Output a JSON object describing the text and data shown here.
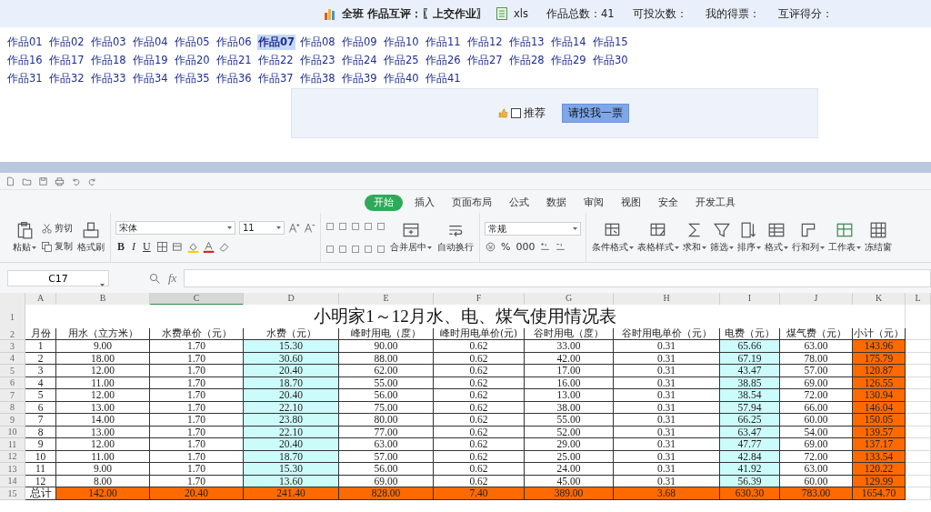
{
  "header": {
    "title": "全班 作品互评：〖上交作业〗",
    "file_type": "xls",
    "stats": [
      "作品总数：41",
      "可投次数：",
      "我的得票：",
      "互评得分："
    ]
  },
  "works": [
    {
      "label": "作品01",
      "selected": false
    },
    {
      "label": "作品02",
      "selected": false
    },
    {
      "label": "作品03",
      "selected": false
    },
    {
      "label": "作品04",
      "selected": false
    },
    {
      "label": "作品05",
      "selected": false
    },
    {
      "label": "作品06",
      "selected": false
    },
    {
      "label": "作品07",
      "selected": true
    },
    {
      "label": "作品08",
      "selected": false
    },
    {
      "label": "作品09",
      "selected": false
    },
    {
      "label": "作品10",
      "selected": false
    },
    {
      "label": "作品11",
      "selected": false
    },
    {
      "label": "作品12",
      "selected": false
    },
    {
      "label": "作品13",
      "selected": false
    },
    {
      "label": "作品14",
      "selected": false
    },
    {
      "label": "作品15",
      "selected": false
    },
    {
      "label": "作品16",
      "selected": false
    },
    {
      "label": "作品17",
      "selected": false
    },
    {
      "label": "作品18",
      "selected": false
    },
    {
      "label": "作品19",
      "selected": false
    },
    {
      "label": "作品20",
      "selected": false
    },
    {
      "label": "作品21",
      "selected": false
    },
    {
      "label": "作品22",
      "selected": false
    },
    {
      "label": "作品23",
      "selected": false
    },
    {
      "label": "作品24",
      "selected": false
    },
    {
      "label": "作品25",
      "selected": false
    },
    {
      "label": "作品26",
      "selected": false
    },
    {
      "label": "作品27",
      "selected": false
    },
    {
      "label": "作品28",
      "selected": false
    },
    {
      "label": "作品29",
      "selected": false
    },
    {
      "label": "作品30",
      "selected": false
    },
    {
      "label": "作品31",
      "selected": false
    },
    {
      "label": "作品32",
      "selected": false
    },
    {
      "label": "作品33",
      "selected": false
    },
    {
      "label": "作品34",
      "selected": false
    },
    {
      "label": "作品35",
      "selected": false
    },
    {
      "label": "作品36",
      "selected": false
    },
    {
      "label": "作品37",
      "selected": false
    },
    {
      "label": "作品38",
      "selected": false
    },
    {
      "label": "作品39",
      "selected": false
    },
    {
      "label": "作品40",
      "selected": false
    },
    {
      "label": "作品41",
      "selected": false
    }
  ],
  "vote": {
    "recommend_label": "推荐",
    "recommend_checked": false,
    "button": "请投我一票"
  },
  "spreadsheet": {
    "tabs": [
      {
        "label": "开始",
        "selected": true
      },
      {
        "label": "插入",
        "selected": false
      },
      {
        "label": "页面布局",
        "selected": false
      },
      {
        "label": "公式",
        "selected": false
      },
      {
        "label": "数据",
        "selected": false
      },
      {
        "label": "审阅",
        "selected": false
      },
      {
        "label": "视图",
        "selected": false
      },
      {
        "label": "安全",
        "selected": false
      },
      {
        "label": "开发工具",
        "selected": false
      }
    ],
    "ribbon": {
      "clipboard": {
        "paste": "粘贴",
        "cut": "剪切",
        "copy": "复制",
        "format_painter": "格式刷"
      },
      "font": {
        "name": "宋体",
        "size": "11",
        "styles": [
          "B",
          "I",
          "U"
        ]
      },
      "alignment": {
        "merge": "合并居中",
        "wrap": "自动换行"
      },
      "number": {
        "format": "常规",
        "percent": "%",
        "thousands": "000"
      },
      "tools": [
        {
          "label": "条件格式",
          "kind": "condition",
          "dropdown": true
        },
        {
          "label": "表格样式",
          "kind": "style",
          "dropdown": true
        },
        {
          "label": "求和",
          "kind": "sum",
          "dropdown": true
        },
        {
          "label": "筛选",
          "kind": "filter",
          "dropdown": true
        },
        {
          "label": "排序",
          "kind": "sort",
          "dropdown": true
        },
        {
          "label": "格式",
          "kind": "format",
          "dropdown": true
        },
        {
          "label": "行和列",
          "kind": "rowcol",
          "dropdown": true
        },
        {
          "label": "工作表",
          "kind": "sheet",
          "dropdown": true
        },
        {
          "label": "冻结窗",
          "kind": "freeze",
          "dropdown": false
        }
      ]
    },
    "formula_bar": {
      "cell": "C17",
      "fx": "fx"
    },
    "columns": [
      {
        "letter": "A",
        "selected": false,
        "kind": "plain"
      },
      {
        "letter": "B",
        "selected": false,
        "kind": "plain"
      },
      {
        "letter": "C",
        "selected": true,
        "kind": "plain"
      },
      {
        "letter": "D",
        "selected": false,
        "kind": "calc"
      },
      {
        "letter": "E",
        "selected": false,
        "kind": "plain"
      },
      {
        "letter": "F",
        "selected": false,
        "kind": "plain"
      },
      {
        "letter": "G",
        "selected": false,
        "kind": "plain"
      },
      {
        "letter": "H",
        "selected": false,
        "kind": "plain"
      },
      {
        "letter": "I",
        "selected": false,
        "kind": "calc"
      },
      {
        "letter": "J",
        "selected": false,
        "kind": "plain"
      },
      {
        "letter": "K",
        "selected": false,
        "kind": "sum"
      },
      {
        "letter": "L",
        "selected": false
      }
    ],
    "title_row": {
      "number": "1",
      "title": "小明家1～12月水、电、煤气使用情况表"
    },
    "header_row": {
      "number": "2",
      "cells": [
        "月份",
        "用水（立方米）",
        "水费单价（元）",
        "水费（元）",
        "峰时用电（度）",
        "峰时用电单价(元)",
        "谷时用电（度）",
        "谷时用电单价（元）",
        "电费（元）",
        "煤气费（元）",
        "小计（元）"
      ]
    },
    "rows": [
      {
        "number": "3",
        "kind": "data",
        "cells": [
          "1",
          "9.00",
          "1.70",
          "15.30",
          "90.00",
          "0.62",
          "33.00",
          "0.31",
          "65.66",
          "63.00",
          "143.96"
        ]
      },
      {
        "number": "4",
        "kind": "data",
        "cells": [
          "2",
          "18.00",
          "1.70",
          "30.60",
          "88.00",
          "0.62",
          "42.00",
          "0.31",
          "67.19",
          "78.00",
          "175.79"
        ]
      },
      {
        "number": "5",
        "kind": "data",
        "cells": [
          "3",
          "12.00",
          "1.70",
          "20.40",
          "62.00",
          "0.62",
          "17.00",
          "0.31",
          "43.47",
          "57.00",
          "120.87"
        ]
      },
      {
        "number": "6",
        "kind": "data",
        "cells": [
          "4",
          "11.00",
          "1.70",
          "18.70",
          "55.00",
          "0.62",
          "16.00",
          "0.31",
          "38.85",
          "69.00",
          "126.55"
        ]
      },
      {
        "number": "7",
        "kind": "data",
        "cells": [
          "5",
          "12.00",
          "1.70",
          "20.40",
          "56.00",
          "0.62",
          "13.00",
          "0.31",
          "38.54",
          "72.00",
          "130.94"
        ]
      },
      {
        "number": "8",
        "kind": "data",
        "cells": [
          "6",
          "13.00",
          "1.70",
          "22.10",
          "75.00",
          "0.62",
          "38.00",
          "0.31",
          "57.94",
          "66.00",
          "146.04"
        ]
      },
      {
        "number": "9",
        "kind": "data",
        "cells": [
          "7",
          "14.00",
          "1.70",
          "23.80",
          "80.00",
          "0.62",
          "55.00",
          "0.31",
          "66.25",
          "60.00",
          "150.05"
        ]
      },
      {
        "number": "10",
        "kind": "data",
        "cells": [
          "8",
          "13.00",
          "1.70",
          "22.10",
          "77.00",
          "0.62",
          "52.00",
          "0.31",
          "63.47",
          "54.00",
          "139.57"
        ]
      },
      {
        "number": "11",
        "kind": "data",
        "cells": [
          "9",
          "12.00",
          "1.70",
          "20.40",
          "63.00",
          "0.62",
          "29.00",
          "0.31",
          "47.77",
          "69.00",
          "137.17"
        ]
      },
      {
        "number": "12",
        "kind": "data",
        "cells": [
          "10",
          "11.00",
          "1.70",
          "18.70",
          "57.00",
          "0.62",
          "25.00",
          "0.31",
          "42.84",
          "72.00",
          "133.54"
        ]
      },
      {
        "number": "13",
        "kind": "data",
        "cells": [
          "11",
          "9.00",
          "1.70",
          "15.30",
          "56.00",
          "0.62",
          "24.00",
          "0.31",
          "41.92",
          "63.00",
          "120.22"
        ]
      },
      {
        "number": "14",
        "kind": "data",
        "cells": [
          "12",
          "8.00",
          "1.70",
          "13.60",
          "69.00",
          "0.62",
          "45.00",
          "0.31",
          "56.39",
          "60.00",
          "129.99"
        ]
      },
      {
        "number": "15",
        "kind": "total",
        "cells": [
          "总计",
          "142.00",
          "20.40",
          "241.40",
          "828.00",
          "7.40",
          "389.00",
          "3.68",
          "630.30",
          "783.00",
          "1654.70"
        ]
      }
    ]
  }
}
